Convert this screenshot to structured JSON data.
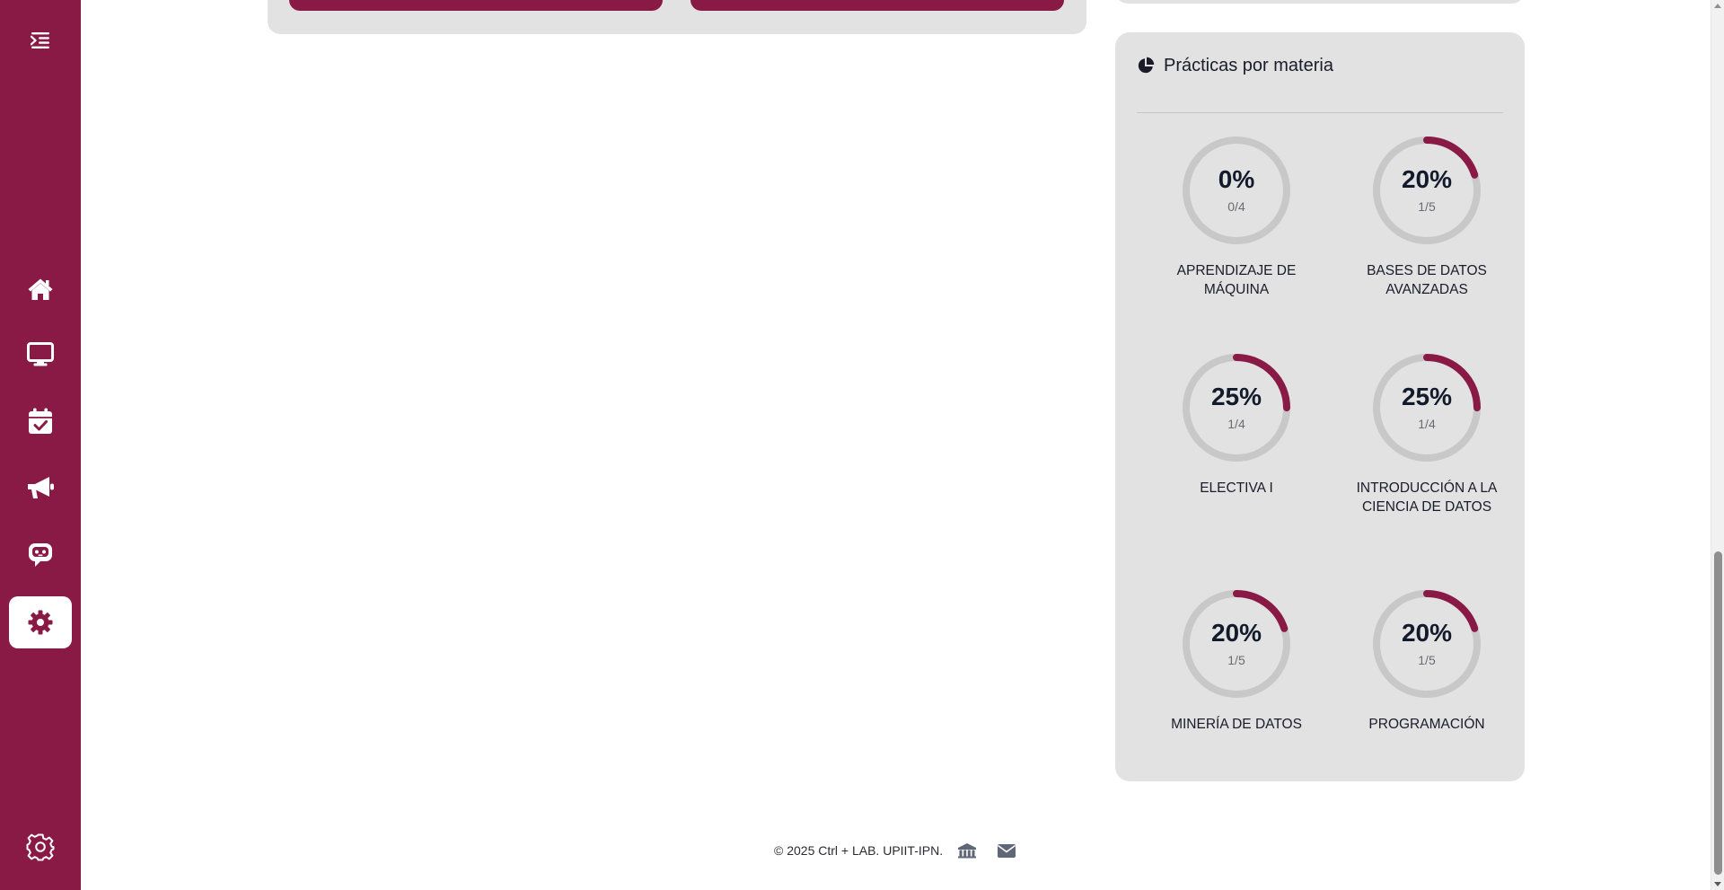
{
  "sidebar": {
    "items": [
      {
        "name": "menu-toggle-icon"
      },
      {
        "name": "home-icon"
      },
      {
        "name": "monitor-icon"
      },
      {
        "name": "calendar-check-icon"
      },
      {
        "name": "megaphone-icon"
      },
      {
        "name": "chat-bot-icon"
      },
      {
        "name": "gear-icon",
        "active": true
      },
      {
        "name": "settings-outline-icon"
      }
    ]
  },
  "practicas": {
    "title": "Prácticas por materia",
    "icon": "chart-pie-icon",
    "items": [
      {
        "percent": "0%",
        "fraction": "0/4",
        "subject": "APRENDIZAJE DE MÁQUINA",
        "progress": 0.0
      },
      {
        "percent": "20%",
        "fraction": "1/5",
        "subject": "BASES DE DATOS AVANZADAS",
        "progress": 0.2
      },
      {
        "percent": "25%",
        "fraction": "1/4",
        "subject": "ELECTIVA I",
        "progress": 0.25
      },
      {
        "percent": "25%",
        "fraction": "1/4",
        "subject": "INTRODUCCIÓN A LA CIENCIA DE DATOS",
        "progress": 0.25
      },
      {
        "percent": "20%",
        "fraction": "1/5",
        "subject": "MINERÍA DE DATOS",
        "progress": 0.2
      },
      {
        "percent": "20%",
        "fraction": "1/5",
        "subject": "PROGRAMACIÓN",
        "progress": 0.2
      }
    ]
  },
  "footer": {
    "copyright": "© 2025 Ctrl + LAB. UPIIT-IPN.",
    "icons": [
      "institution-icon",
      "envelope-icon"
    ]
  },
  "colors": {
    "brand": "#891a45",
    "card": "#e2e2e2",
    "ring_track": "#c8c8c8"
  }
}
